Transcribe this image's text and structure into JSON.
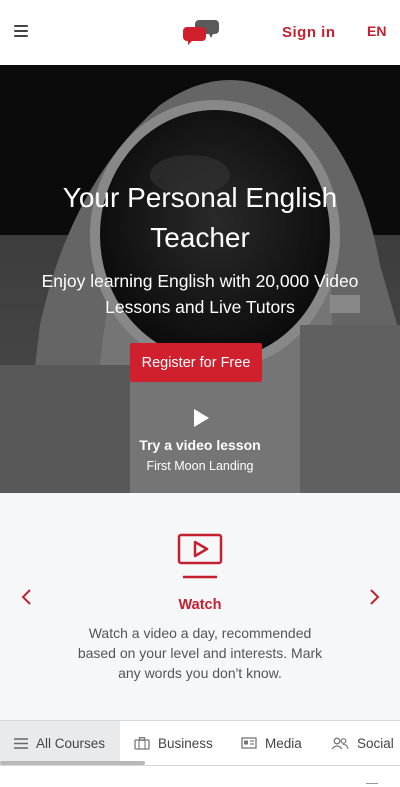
{
  "header": {
    "menu_icon": "hamburger-menu-icon",
    "logo_icon": "speech-bubbles-logo",
    "signin_label": "Sign in",
    "language_label": "EN",
    "accent_color": "#c4202f"
  },
  "hero": {
    "title": "Your Personal English Teacher",
    "subtitle": "Enjoy learning English with 20,000 Video Lessons and Live Tutors",
    "register_label": "Register for Free",
    "play_icon": "play-icon",
    "try_label": "Try a video lesson",
    "video_name": "First Moon Landing"
  },
  "feature": {
    "icon": "video-screen-icon",
    "title": "Watch",
    "description": "Watch a video a day, recommended based on your level and interests. Mark any words you don't know."
  },
  "categories": [
    {
      "label": "All Courses",
      "icon": "list-icon",
      "active": true
    },
    {
      "label": "Business",
      "icon": "briefcase-icon",
      "active": false
    },
    {
      "label": "Media",
      "icon": "newspaper-icon",
      "active": false
    },
    {
      "label": "Social",
      "icon": "people-icon",
      "active": false
    }
  ]
}
